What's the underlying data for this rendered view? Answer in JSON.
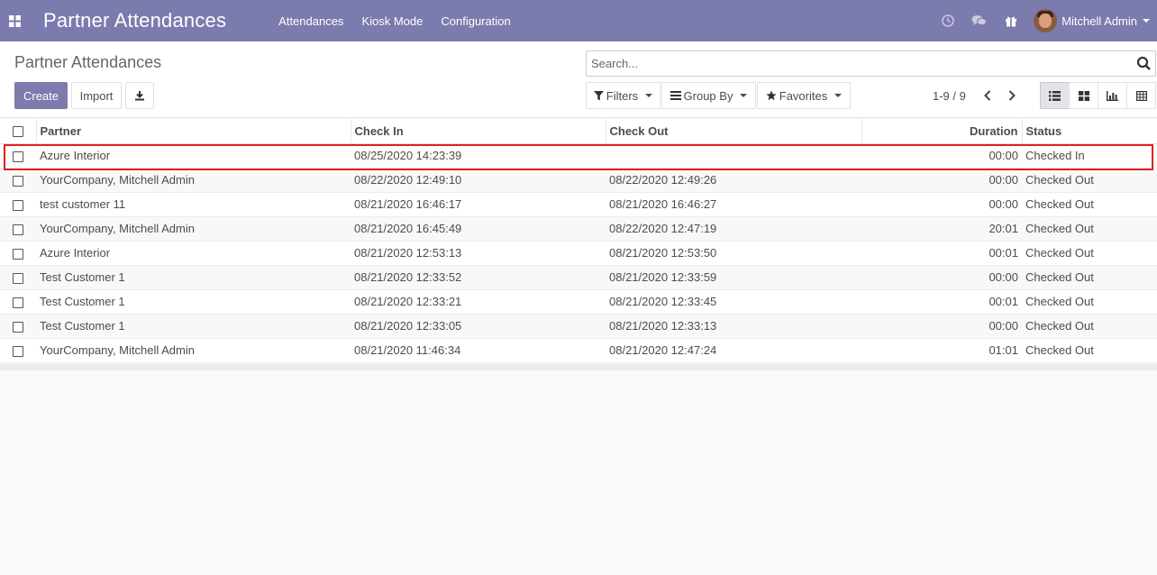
{
  "navbar": {
    "app_icon": "apps-grid-icon",
    "brand": "Partner Attendances",
    "menu": [
      "Attendances",
      "Kiosk Mode",
      "Configuration"
    ],
    "user_name": "Mitchell Admin"
  },
  "control_panel": {
    "breadcrumb": "Partner Attendances",
    "create_label": "Create",
    "import_label": "Import",
    "search_placeholder": "Search...",
    "filters_label": "Filters",
    "groupby_label": "Group By",
    "favorites_label": "Favorites",
    "pager": "1-9 / 9"
  },
  "table": {
    "headers": [
      "Partner",
      "Check In",
      "Check Out",
      "Duration",
      "Status"
    ],
    "rows": [
      {
        "partner": "Azure Interior",
        "check_in": "08/25/2020 14:23:39",
        "check_out": "",
        "duration": "00:00",
        "status": "Checked In"
      },
      {
        "partner": "YourCompany, Mitchell Admin",
        "check_in": "08/22/2020 12:49:10",
        "check_out": "08/22/2020 12:49:26",
        "duration": "00:00",
        "status": "Checked Out"
      },
      {
        "partner": "test customer 11",
        "check_in": "08/21/2020 16:46:17",
        "check_out": "08/21/2020 16:46:27",
        "duration": "00:00",
        "status": "Checked Out"
      },
      {
        "partner": "YourCompany, Mitchell Admin",
        "check_in": "08/21/2020 16:45:49",
        "check_out": "08/22/2020 12:47:19",
        "duration": "20:01",
        "status": "Checked Out"
      },
      {
        "partner": "Azure Interior",
        "check_in": "08/21/2020 12:53:13",
        "check_out": "08/21/2020 12:53:50",
        "duration": "00:01",
        "status": "Checked Out"
      },
      {
        "partner": "Test Customer 1",
        "check_in": "08/21/2020 12:33:52",
        "check_out": "08/21/2020 12:33:59",
        "duration": "00:00",
        "status": "Checked Out"
      },
      {
        "partner": "Test Customer 1",
        "check_in": "08/21/2020 12:33:21",
        "check_out": "08/21/2020 12:33:45",
        "duration": "00:01",
        "status": "Checked Out"
      },
      {
        "partner": "Test Customer 1",
        "check_in": "08/21/2020 12:33:05",
        "check_out": "08/21/2020 12:33:13",
        "duration": "00:00",
        "status": "Checked Out"
      },
      {
        "partner": "YourCompany, Mitchell Admin",
        "check_in": "08/21/2020 11:46:34",
        "check_out": "08/21/2020 12:47:24",
        "duration": "01:01",
        "status": "Checked Out"
      }
    ]
  },
  "colors": {
    "brand": "#7c7bad",
    "highlight": "#e01f1f"
  }
}
